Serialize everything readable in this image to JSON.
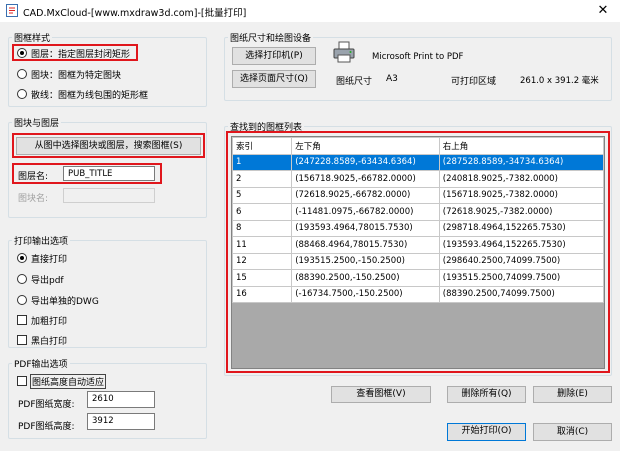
{
  "window": {
    "title": "CAD.MxCloud-[www.mxdraw3d.com]-[批量打印]",
    "close_glyph": "✕"
  },
  "frame_style": {
    "title": "图框样式",
    "options": [
      {
        "label": "图层：指定图层封闭矩形",
        "selected": true
      },
      {
        "label": "图块：图框为特定图块",
        "selected": false
      },
      {
        "label": "散线：图框为线包围的矩形框",
        "selected": false
      }
    ]
  },
  "block_layer": {
    "title": "图块与图层",
    "select_button": "从图中选择图块或图层，搜索图框(S)",
    "layer_label": "图层名:",
    "layer_value": "PUB_TITLE",
    "block_label": "图块名:",
    "block_value": ""
  },
  "print_output": {
    "title": "打印输出选项",
    "options": [
      {
        "label": "直接打印",
        "selected": true
      },
      {
        "label": "导出pdf",
        "selected": false
      },
      {
        "label": "导出单独的DWG",
        "selected": false
      }
    ],
    "checks": [
      {
        "label": "加粗打印",
        "checked": false
      },
      {
        "label": "黑白打印",
        "checked": false
      }
    ]
  },
  "pdf_output": {
    "title": "PDF输出选项",
    "auto_fit_label": "图纸高度自动适应",
    "width_label": "PDF图纸宽度:",
    "width_value": "2610",
    "height_label": "PDF图纸高度:",
    "height_value": "3912"
  },
  "paper": {
    "title": "图纸尺寸和绘图设备",
    "select_printer": "选择打印机(P)",
    "printer_name": "Microsoft Print to PDF",
    "select_page_size": "选择页面尺寸(Q)",
    "size_label": "图纸尺寸",
    "size_value": "A3",
    "area_label": "可打印区域",
    "area_value": "261.0 x 391.2 毫米"
  },
  "frames_list": {
    "title": "查找到的图框列表",
    "columns": [
      "索引",
      "左下角",
      "右上角"
    ],
    "rows": [
      [
        "1",
        "(247228.8589,-63434.6364)",
        "(287528.8589,-34734.6364)"
      ],
      [
        "2",
        "(156718.9025,-66782.0000)",
        "(240818.9025,-7382.0000)"
      ],
      [
        "5",
        "(72618.9025,-66782.0000)",
        "(156718.9025,-7382.0000)"
      ],
      [
        "6",
        "(-11481.0975,-66782.0000)",
        "(72618.9025,-7382.0000)"
      ],
      [
        "8",
        "(193593.4964,78015.7530)",
        "(298718.4964,152265.7530)"
      ],
      [
        "11",
        "(88468.4964,78015.7530)",
        "(193593.4964,152265.7530)"
      ],
      [
        "12",
        "(193515.2500,-150.2500)",
        "(298640.2500,74099.7500)"
      ],
      [
        "15",
        "(88390.2500,-150.2500)",
        "(193515.2500,74099.7500)"
      ],
      [
        "16",
        "(-16734.7500,-150.2500)",
        "(88390.2500,74099.7500)"
      ]
    ],
    "selected_row": 0
  },
  "actions": {
    "view_frame": "查看图框(V)",
    "delete_all": "删除所有(Q)",
    "delete": "删除(E)",
    "start_print": "开始打印(O)",
    "cancel": "取消(C)"
  },
  "colors": {
    "highlight_red": "#e0161c",
    "selection_blue": "#0078d7"
  }
}
